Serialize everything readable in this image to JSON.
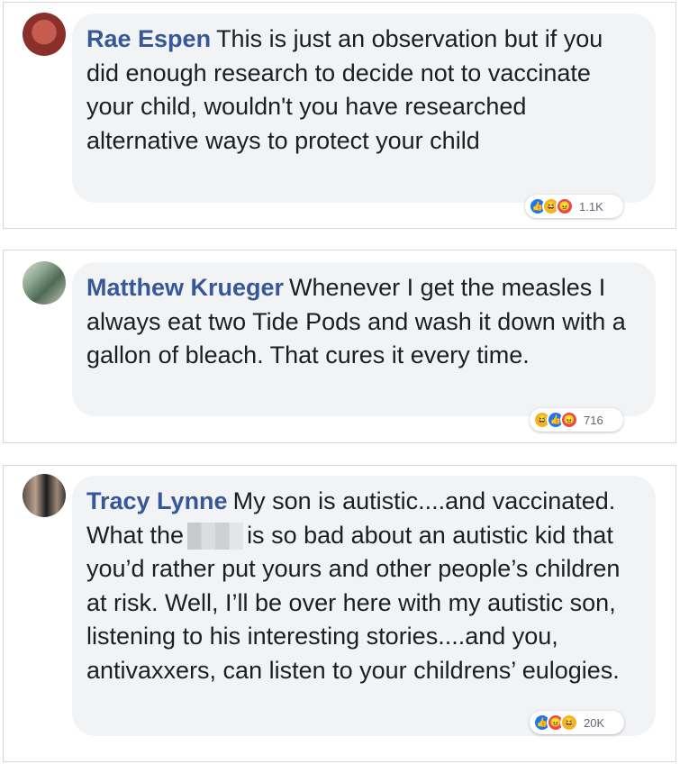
{
  "comments": [
    {
      "author": "Rae Espen",
      "text": "This is just an observation but if you did enough research to decide not to vaccinate your child, wouldn't you have researched alternative ways to protect your child",
      "reaction_icons": [
        "like-icon",
        "haha-icon",
        "angry-icon"
      ],
      "reaction_count": "1.1K"
    },
    {
      "author": "Matthew Krueger",
      "text": "Whenever I get the measles I always eat two Tide Pods and wash it down with a gallon of bleach. That cures it every time.",
      "reaction_icons": [
        "haha-icon",
        "like-icon",
        "angry-icon"
      ],
      "reaction_count": "716"
    },
    {
      "author": "Tracy Lynne",
      "text_before": "My son is autistic....and vaccinated. What the",
      "text_after": "is so bad about an autistic kid that you’d rather put yours and other people’s children at risk. Well, I’ll be over here with my autistic son, listening to his interesting stories....and you, antivaxxers, can listen to your childrens’ eulogies.",
      "reaction_icons": [
        "like-icon",
        "angry-icon",
        "haha-icon"
      ],
      "reaction_count": "20K"
    }
  ],
  "colors": {
    "author_link": "#365899",
    "bubble_bg": "#f2f3f5",
    "text": "#1c1e21",
    "like": "#1877f2",
    "haha": "#f7b125",
    "angry": "#e9484a"
  }
}
